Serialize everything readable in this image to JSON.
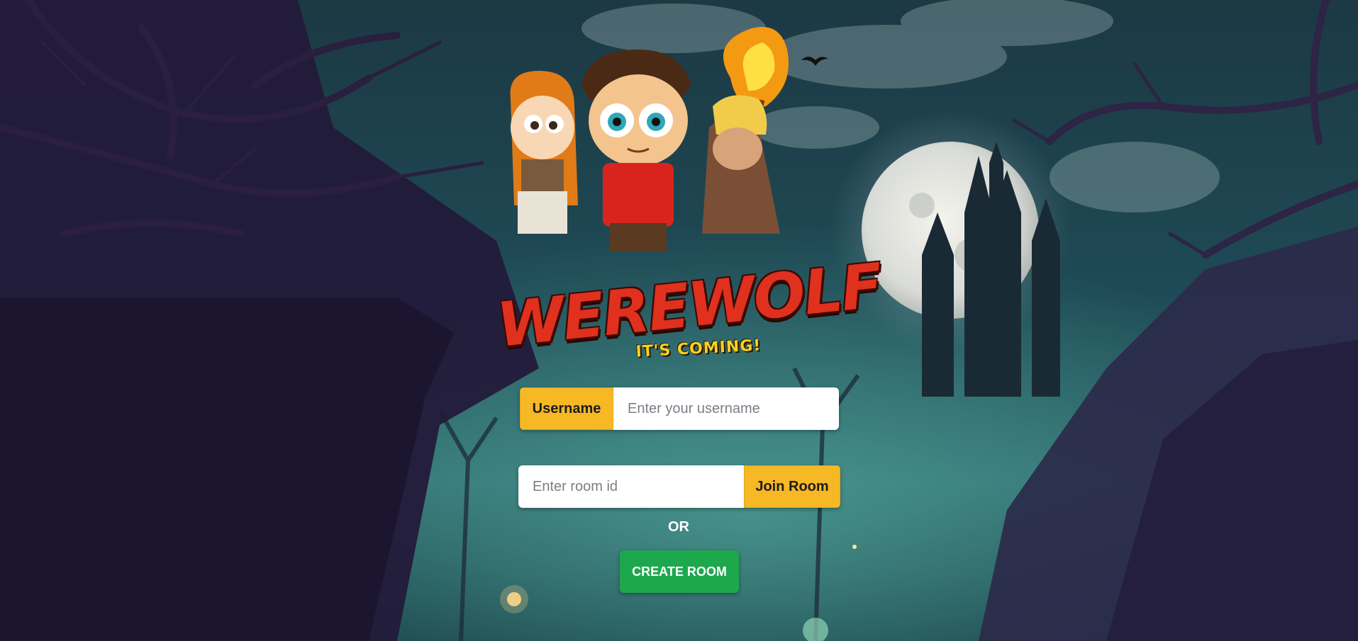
{
  "logo": {
    "title": "WEREWOLF",
    "tagline": "IT'S COMING!"
  },
  "form": {
    "username_label": "Username",
    "username_placeholder": "Enter your username",
    "room_placeholder": "Enter room id",
    "join_label": "Join Room",
    "or_text": "OR",
    "create_label": "CREATE ROOM"
  },
  "colors": {
    "accent_yellow": "#f6b825",
    "create_green": "#1ea84d"
  }
}
